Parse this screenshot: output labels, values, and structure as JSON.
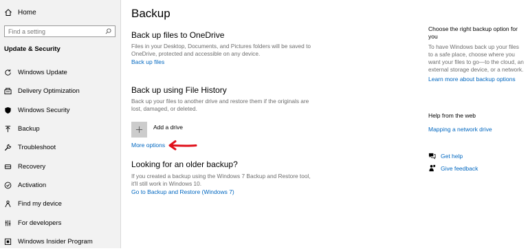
{
  "sidebar": {
    "home_label": "Home",
    "search_placeholder": "Find a setting",
    "section_title": "Update & Security",
    "items": [
      {
        "label": "Windows Update",
        "icon": "refresh-icon"
      },
      {
        "label": "Delivery Optimization",
        "icon": "delivery-optimization-icon"
      },
      {
        "label": "Windows Security",
        "icon": "shield-icon"
      },
      {
        "label": "Backup",
        "icon": "backup-arrow-icon"
      },
      {
        "label": "Troubleshoot",
        "icon": "wrench-icon"
      },
      {
        "label": "Recovery",
        "icon": "recovery-icon"
      },
      {
        "label": "Activation",
        "icon": "check-circle-icon"
      },
      {
        "label": "Find my device",
        "icon": "person-location-icon"
      },
      {
        "label": "For developers",
        "icon": "developer-icon"
      },
      {
        "label": "Windows Insider Program",
        "icon": "insider-icon"
      }
    ]
  },
  "main": {
    "title": "Backup",
    "onedrive": {
      "heading": "Back up files to OneDrive",
      "description": "Files in your Desktop, Documents, and Pictures folders will be saved to OneDrive, protected and accessible on any device.",
      "link": "Back up files"
    },
    "file_history": {
      "heading": "Back up using File History",
      "description": "Back up your files to another drive and restore them if the originals are lost, damaged, or deleted.",
      "add_drive": "Add a drive",
      "more_options": "More options"
    },
    "older": {
      "heading": "Looking for an older backup?",
      "description": "If you created a backup using the Windows 7 Backup and Restore tool, it'll still work in Windows 10.",
      "link": "Go to Backup and Restore (Windows 7)"
    }
  },
  "right": {
    "choose_heading": "Choose the right backup option for you",
    "choose_desc": "To have Windows back up your files to a safe place, choose where you want your files to go—to the cloud, an external storage device, or a network.",
    "choose_link": "Learn more about backup options",
    "help_heading": "Help from the web",
    "help_link": "Mapping a network drive",
    "get_help": "Get help",
    "give_feedback": "Give feedback"
  },
  "colors": {
    "link": "#0067c0",
    "annotation_arrow": "#e0101a",
    "sidebar_bg": "#f2f2f2"
  }
}
